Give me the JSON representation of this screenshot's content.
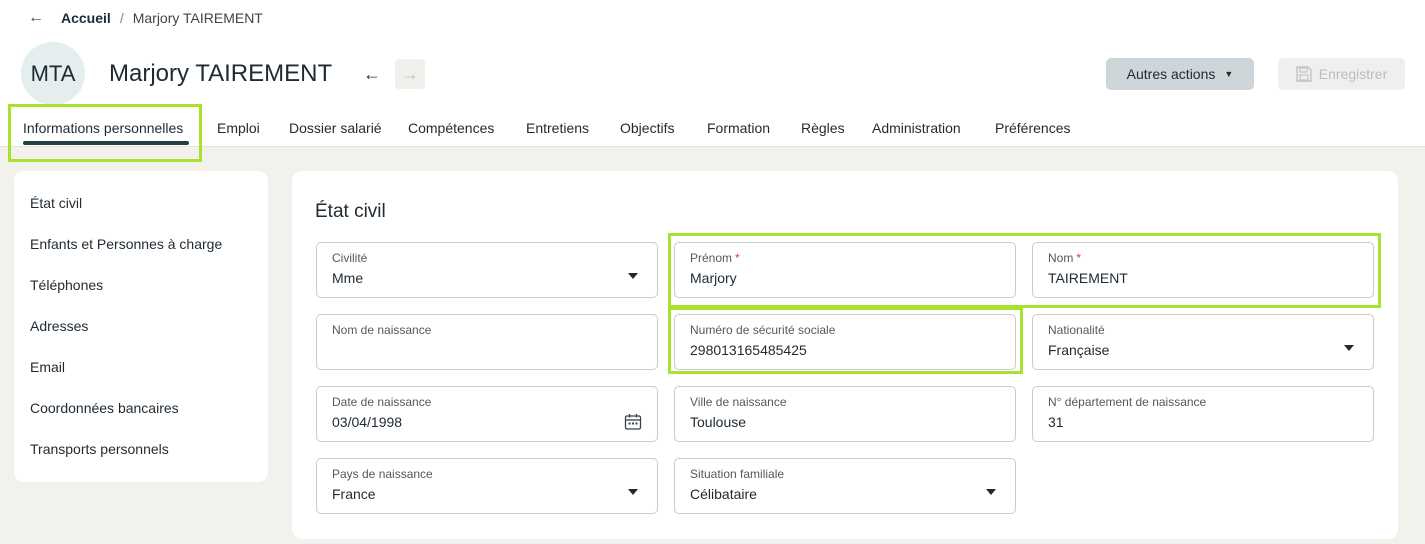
{
  "breadcrumb": {
    "back_icon": "←",
    "home": "Accueil",
    "separator": "/",
    "current": "Marjory TAIREMENT"
  },
  "header": {
    "initials": "MTA",
    "name": "Marjory TAIREMENT",
    "prev_icon": "←",
    "next_icon": "→",
    "actions_label": "Autres actions",
    "actions_caret": "▼",
    "save_label": "Enregistrer"
  },
  "tabs": [
    {
      "label": "Informations personnelles",
      "active": true
    },
    {
      "label": "Emploi"
    },
    {
      "label": "Dossier salarié"
    },
    {
      "label": "Compétences"
    },
    {
      "label": "Entretiens"
    },
    {
      "label": "Objectifs"
    },
    {
      "label": "Formation"
    },
    {
      "label": "Règles"
    },
    {
      "label": "Administration"
    },
    {
      "label": "Préférences"
    }
  ],
  "sidebar": {
    "items": [
      "État civil",
      "Enfants et Personnes à charge",
      "Téléphones",
      "Adresses",
      "Email",
      "Coordonnées bancaires",
      "Transports personnels"
    ]
  },
  "form": {
    "title": "État civil",
    "required_mark": "*",
    "civilite": {
      "label": "Civilité",
      "value": "Mme"
    },
    "prenom": {
      "label": "Prénom",
      "value": "Marjory"
    },
    "nom": {
      "label": "Nom",
      "value": "TAIREMENT"
    },
    "nom_naissance": {
      "label": "Nom de naissance",
      "value": ""
    },
    "secu": {
      "label": "Numéro de sécurité sociale",
      "value": "298013165485425"
    },
    "nationalite": {
      "label": "Nationalité",
      "value": "Française"
    },
    "date_naissance": {
      "label": "Date de naissance",
      "value": "03/04/1998"
    },
    "ville_naissance": {
      "label": "Ville de naissance",
      "value": "Toulouse"
    },
    "dept_naissance": {
      "label": "N° département de naissance",
      "value": "31"
    },
    "pays_naissance": {
      "label": "Pays de naissance",
      "value": "France"
    },
    "situation": {
      "label": "Situation familiale",
      "value": "Célibataire"
    }
  },
  "colors": {
    "highlight": "#a6e22e",
    "tab_underline": "#244042",
    "background": "#f3f1ec",
    "actions_button": "#cfd6da"
  }
}
